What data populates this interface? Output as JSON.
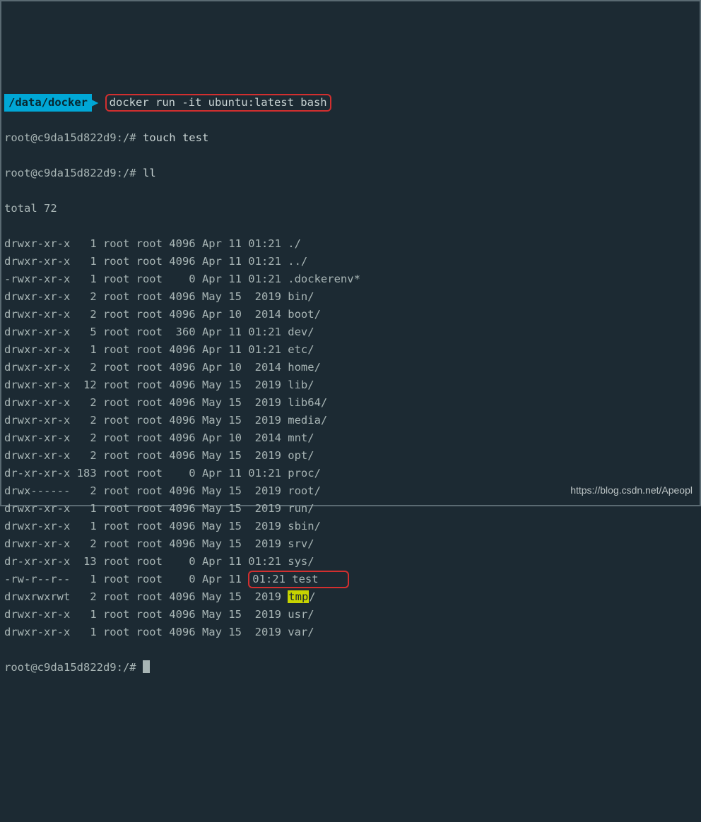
{
  "prompt_badge": "/data/docker",
  "docker_cmd": "docker run -it ubuntu:latest bash",
  "container_prompt": "root@c9da15d822d9:/#",
  "touch_cmd": "touch test",
  "ll_cmd": "ll",
  "total_line": "total 72",
  "rows": [
    {
      "perm": "drwxr-xr-x",
      "lnk": "  1",
      "own": "root",
      "grp": "root",
      "size": "4096",
      "mon": "Apr",
      "day": "11",
      "time": "01:21",
      "name": "./"
    },
    {
      "perm": "drwxr-xr-x",
      "lnk": "  1",
      "own": "root",
      "grp": "root",
      "size": "4096",
      "mon": "Apr",
      "day": "11",
      "time": "01:21",
      "name": "../"
    },
    {
      "perm": "-rwxr-xr-x",
      "lnk": "  1",
      "own": "root",
      "grp": "root",
      "size": "   0",
      "mon": "Apr",
      "day": "11",
      "time": "01:21",
      "name": ".dockerenv*"
    },
    {
      "perm": "drwxr-xr-x",
      "lnk": "  2",
      "own": "root",
      "grp": "root",
      "size": "4096",
      "mon": "May",
      "day": "15",
      "time": " 2019",
      "name": "bin/"
    },
    {
      "perm": "drwxr-xr-x",
      "lnk": "  2",
      "own": "root",
      "grp": "root",
      "size": "4096",
      "mon": "Apr",
      "day": "10",
      "time": " 2014",
      "name": "boot/"
    },
    {
      "perm": "drwxr-xr-x",
      "lnk": "  5",
      "own": "root",
      "grp": "root",
      "size": " 360",
      "mon": "Apr",
      "day": "11",
      "time": "01:21",
      "name": "dev/"
    },
    {
      "perm": "drwxr-xr-x",
      "lnk": "  1",
      "own": "root",
      "grp": "root",
      "size": "4096",
      "mon": "Apr",
      "day": "11",
      "time": "01:21",
      "name": "etc/"
    },
    {
      "perm": "drwxr-xr-x",
      "lnk": "  2",
      "own": "root",
      "grp": "root",
      "size": "4096",
      "mon": "Apr",
      "day": "10",
      "time": " 2014",
      "name": "home/"
    },
    {
      "perm": "drwxr-xr-x",
      "lnk": " 12",
      "own": "root",
      "grp": "root",
      "size": "4096",
      "mon": "May",
      "day": "15",
      "time": " 2019",
      "name": "lib/"
    },
    {
      "perm": "drwxr-xr-x",
      "lnk": "  2",
      "own": "root",
      "grp": "root",
      "size": "4096",
      "mon": "May",
      "day": "15",
      "time": " 2019",
      "name": "lib64/"
    },
    {
      "perm": "drwxr-xr-x",
      "lnk": "  2",
      "own": "root",
      "grp": "root",
      "size": "4096",
      "mon": "May",
      "day": "15",
      "time": " 2019",
      "name": "media/"
    },
    {
      "perm": "drwxr-xr-x",
      "lnk": "  2",
      "own": "root",
      "grp": "root",
      "size": "4096",
      "mon": "Apr",
      "day": "10",
      "time": " 2014",
      "name": "mnt/"
    },
    {
      "perm": "drwxr-xr-x",
      "lnk": "  2",
      "own": "root",
      "grp": "root",
      "size": "4096",
      "mon": "May",
      "day": "15",
      "time": " 2019",
      "name": "opt/"
    },
    {
      "perm": "dr-xr-xr-x",
      "lnk": "183",
      "own": "root",
      "grp": "root",
      "size": "   0",
      "mon": "Apr",
      "day": "11",
      "time": "01:21",
      "name": "proc/"
    },
    {
      "perm": "drwx------",
      "lnk": "  2",
      "own": "root",
      "grp": "root",
      "size": "4096",
      "mon": "May",
      "day": "15",
      "time": " 2019",
      "name": "root/"
    },
    {
      "perm": "drwxr-xr-x",
      "lnk": "  1",
      "own": "root",
      "grp": "root",
      "size": "4096",
      "mon": "May",
      "day": "15",
      "time": " 2019",
      "name": "run/"
    },
    {
      "perm": "drwxr-xr-x",
      "lnk": "  1",
      "own": "root",
      "grp": "root",
      "size": "4096",
      "mon": "May",
      "day": "15",
      "time": " 2019",
      "name": "sbin/"
    },
    {
      "perm": "drwxr-xr-x",
      "lnk": "  2",
      "own": "root",
      "grp": "root",
      "size": "4096",
      "mon": "May",
      "day": "15",
      "time": " 2019",
      "name": "srv/"
    },
    {
      "perm": "dr-xr-xr-x",
      "lnk": " 13",
      "own": "root",
      "grp": "root",
      "size": "   0",
      "mon": "Apr",
      "day": "11",
      "time": "01:21",
      "name": "sys/"
    },
    {
      "perm": "-rw-r--r--",
      "lnk": "  1",
      "own": "root",
      "grp": "root",
      "size": "   0",
      "mon": "Apr",
      "day": "11",
      "time": "01:21",
      "name": "test",
      "hl": "red"
    },
    {
      "perm": "drwxrwxrwt",
      "lnk": "  2",
      "own": "root",
      "grp": "root",
      "size": "4096",
      "mon": "May",
      "day": "15",
      "time": " 2019",
      "name": "tmp",
      "suffix": "/",
      "hl": "tmp"
    },
    {
      "perm": "drwxr-xr-x",
      "lnk": "  1",
      "own": "root",
      "grp": "root",
      "size": "4096",
      "mon": "May",
      "day": "15",
      "time": " 2019",
      "name": "usr/"
    },
    {
      "perm": "drwxr-xr-x",
      "lnk": "  1",
      "own": "root",
      "grp": "root",
      "size": "4096",
      "mon": "May",
      "day": "15",
      "time": " 2019",
      "name": "var/"
    }
  ],
  "watermark": "https://blog.csdn.net/Apeopl"
}
